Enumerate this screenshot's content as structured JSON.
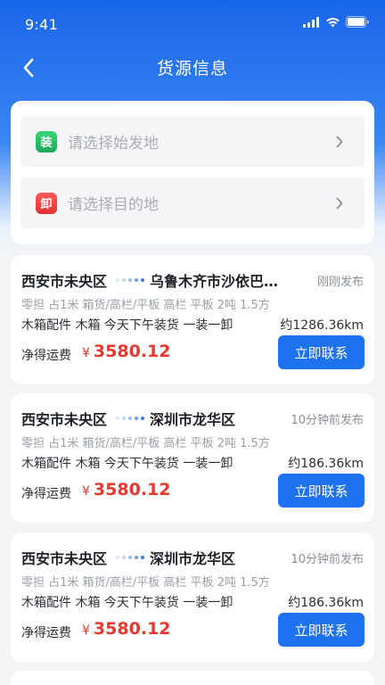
{
  "status_bar": {
    "time": "9:41"
  },
  "nav": {
    "title": "货源信息"
  },
  "route": {
    "from_badge": "装",
    "from_placeholder": "请选择始发地",
    "to_badge": "卸",
    "to_placeholder": "请选择目的地"
  },
  "cargo_list": [
    {
      "origin": "西安市未央区",
      "destination": "乌鲁木齐市沙依巴克区",
      "post_time": "刚刚发布",
      "spec": "零担 占1米 箱货/高栏/平板 高栏 平板 2吨 1.5方",
      "goods": "木箱配件 木箱 今天下午装货 一装一卸",
      "distance": "约1286.36km",
      "fee_label": "净得运费",
      "currency": "¥",
      "fee": "3580.12",
      "button": "立即联系"
    },
    {
      "origin": "西安市未央区",
      "destination": "深圳市龙华区",
      "post_time": "10分钟前发布",
      "spec": "零担 占1米 箱货/高栏/平板 高栏 平板 2吨 1.5方",
      "goods": "木箱配件 木箱 今天下午装货 一装一卸",
      "distance": "约186.36km",
      "fee_label": "净得运费",
      "currency": "¥",
      "fee": "3580.12",
      "button": "立即联系"
    },
    {
      "origin": "西安市未央区",
      "destination": "深圳市龙华区",
      "post_time": "10分钟前发布",
      "spec": "零担 占1米 箱货/高栏/平板 高栏 平板 2吨 1.5方",
      "goods": "木箱配件 木箱 今天下午装货 一装一卸",
      "distance": "约186.36km",
      "fee_label": "净得运费",
      "currency": "¥",
      "fee": "3580.12",
      "button": "立即联系"
    }
  ],
  "colors": {
    "primary": "#1e71ef",
    "fee": "#e8382f",
    "load_badge": "#1faa58",
    "unload_badge": "#e23131"
  },
  "icons": [
    "signal-icon",
    "wifi-icon",
    "battery-icon",
    "back-arrow-icon",
    "chevron-right-icon",
    "route-dots-icon"
  ]
}
